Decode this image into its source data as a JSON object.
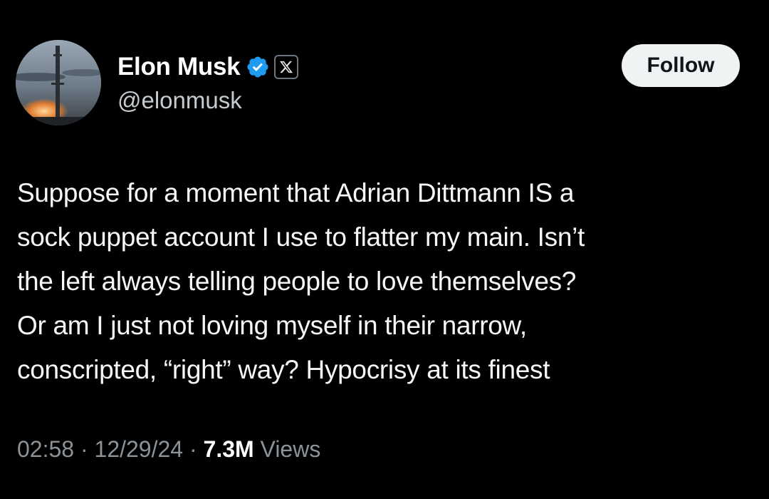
{
  "author": {
    "display_name": "Elon Musk",
    "handle": "@elonmusk",
    "verified_icon": "verified-badge-icon",
    "affiliation_icon": "x-logo-icon"
  },
  "follow_button": {
    "label": "Follow"
  },
  "tweet": {
    "lines": [
      "Suppose for a moment that Adrian Dittmann IS a",
      "sock puppet account I use to flatter my main. Isn’t",
      "the left always telling people to love themselves?",
      "Or am I just not loving myself in their narrow,",
      "conscripted, “right” way? Hypocrisy at its finest"
    ]
  },
  "meta": {
    "time": "02:58",
    "date": "12/29/24",
    "separator": " · ",
    "views_count": "7.3M",
    "views_label": " Views"
  },
  "colors": {
    "background": "#000000",
    "verified_blue": "#1d9bf0",
    "follow_bg": "#eff3f4",
    "muted_text": "#8b9399"
  }
}
